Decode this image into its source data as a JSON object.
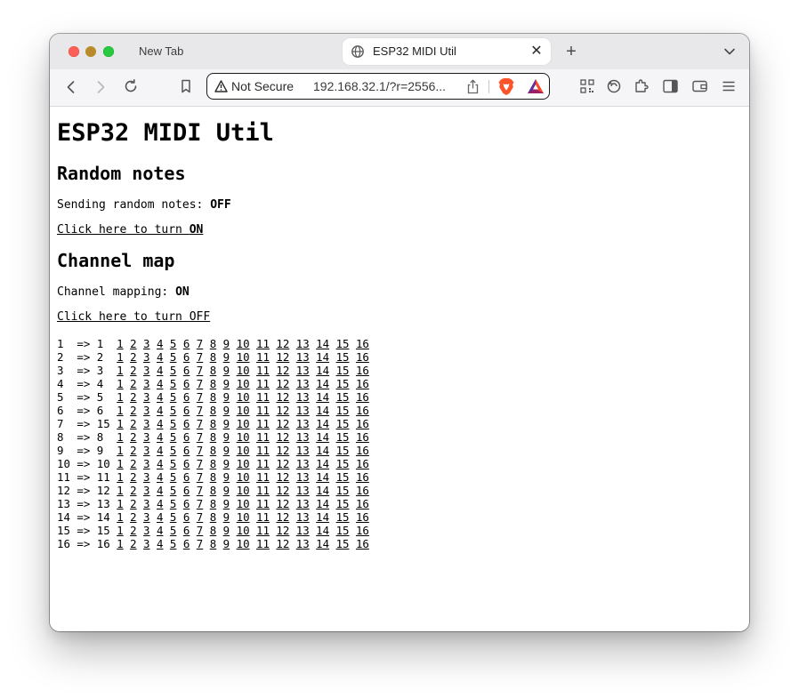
{
  "browser": {
    "inactive_tab_title": "New Tab",
    "active_tab_title": "ESP32 MIDI Util",
    "security_label": "Not Secure",
    "url": "192.168.32.1/?r=2556...",
    "close_tab_label": "✕",
    "new_tab_label": "+"
  },
  "page": {
    "title": "ESP32 MIDI Util",
    "random_notes": {
      "heading": "Random notes",
      "status_label": "Sending random notes: ",
      "status_value": "OFF",
      "toggle_prefix": "Click here to turn ",
      "toggle_value": "ON"
    },
    "channel_map": {
      "heading": "Channel map",
      "status_label": "Channel mapping: ",
      "status_value": "ON",
      "toggle_prefix": "Click here to turn ",
      "toggle_value": "OFF",
      "arrow": "=>",
      "choices": [
        "1",
        "2",
        "3",
        "4",
        "5",
        "6",
        "7",
        "8",
        "9",
        "10",
        "11",
        "12",
        "13",
        "14",
        "15",
        "16"
      ],
      "rows": [
        {
          "from": "1",
          "to": "1"
        },
        {
          "from": "2",
          "to": "2"
        },
        {
          "from": "3",
          "to": "3"
        },
        {
          "from": "4",
          "to": "4"
        },
        {
          "from": "5",
          "to": "5"
        },
        {
          "from": "6",
          "to": "6"
        },
        {
          "from": "7",
          "to": "15"
        },
        {
          "from": "8",
          "to": "8"
        },
        {
          "from": "9",
          "to": "9"
        },
        {
          "from": "10",
          "to": "10"
        },
        {
          "from": "11",
          "to": "11"
        },
        {
          "from": "12",
          "to": "12"
        },
        {
          "from": "13",
          "to": "13"
        },
        {
          "from": "14",
          "to": "14"
        },
        {
          "from": "15",
          "to": "15"
        },
        {
          "from": "16",
          "to": "16"
        }
      ]
    }
  }
}
